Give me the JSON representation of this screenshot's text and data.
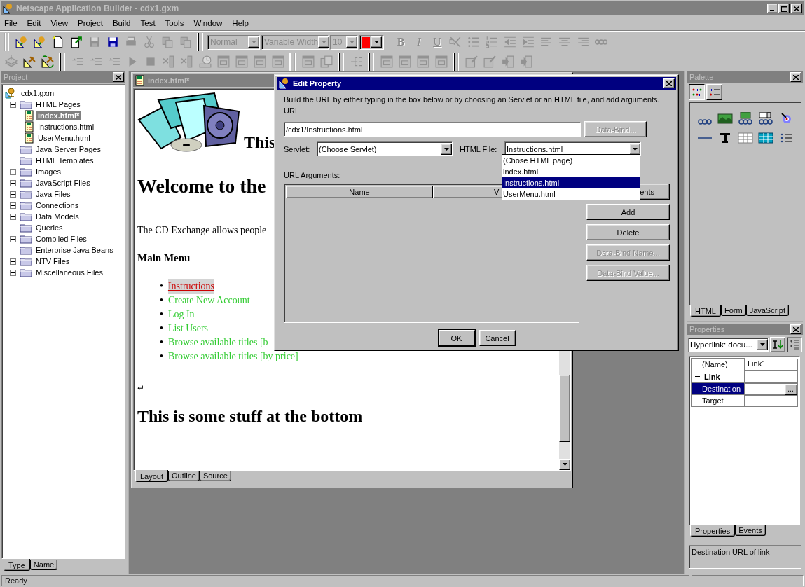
{
  "window": {
    "title": "Netscape Application Builder - cdx1.gxm"
  },
  "menu": [
    "File",
    "Edit",
    "View",
    "Project",
    "Build",
    "Test",
    "Tools",
    "Window",
    "Help"
  ],
  "toolbars": [
    {
      "items": [
        {
          "kind": "separator"
        },
        {
          "kind": "icon",
          "disabled": false
        },
        {
          "kind": "icon",
          "disabled": false
        },
        {
          "kind": "icon",
          "disabled": false
        },
        {
          "kind": "icon",
          "disabled": false
        },
        {
          "kind": "icon",
          "disabled": true
        },
        {
          "kind": "icon",
          "disabled": false
        },
        {
          "kind": "icon",
          "disabled": true
        },
        {
          "kind": "icon",
          "disabled": true
        },
        {
          "kind": "icon",
          "disabled": true
        },
        {
          "kind": "icon",
          "disabled": true
        },
        {
          "kind": "separator"
        },
        {
          "kind": "combo",
          "value": "Normal",
          "disabled": true
        },
        {
          "kind": "combo",
          "value": "Variable Width",
          "disabled": true
        },
        {
          "kind": "combo",
          "value": "10",
          "disabled": true
        },
        {
          "kind": "color",
          "color": "#ff0000"
        },
        {
          "kind": "letter",
          "label": "B",
          "disabled": true
        },
        {
          "kind": "letter",
          "label": "I",
          "disabled": true
        },
        {
          "kind": "letter",
          "label": "U",
          "disabled": true
        },
        {
          "kind": "icon",
          "disabled": true
        },
        {
          "kind": "icon",
          "disabled": true
        },
        {
          "kind": "icon",
          "disabled": true
        },
        {
          "kind": "icon",
          "disabled": true
        },
        {
          "kind": "icon",
          "disabled": true
        },
        {
          "kind": "icon",
          "disabled": true
        },
        {
          "kind": "icon",
          "disabled": true
        },
        {
          "kind": "icon",
          "disabled": true
        },
        {
          "kind": "icon",
          "disabled": true
        }
      ]
    },
    {
      "items": [
        {
          "kind": "icon",
          "disabled": true
        },
        {
          "kind": "icon",
          "disabled": false
        },
        {
          "kind": "icon",
          "disabled": false
        },
        {
          "kind": "separator"
        },
        {
          "kind": "icon",
          "disabled": true
        },
        {
          "kind": "icon",
          "disabled": true
        },
        {
          "kind": "icon",
          "disabled": true
        },
        {
          "kind": "icon",
          "disabled": true
        },
        {
          "kind": "icon",
          "disabled": true
        },
        {
          "kind": "icon",
          "disabled": true
        },
        {
          "kind": "icon",
          "disabled": true
        },
        {
          "kind": "icon",
          "disabled": true
        },
        {
          "kind": "icon",
          "disabled": true
        },
        {
          "kind": "icon",
          "disabled": true
        },
        {
          "kind": "icon",
          "disabled": true
        },
        {
          "kind": "icon",
          "disabled": true
        },
        {
          "kind": "separator"
        },
        {
          "kind": "icon",
          "disabled": true
        },
        {
          "kind": "icon",
          "disabled": true
        },
        {
          "kind": "separator"
        },
        {
          "kind": "icon",
          "disabled": true
        },
        {
          "kind": "separator"
        },
        {
          "kind": "icon",
          "disabled": true
        },
        {
          "kind": "icon",
          "disabled": true
        },
        {
          "kind": "icon",
          "disabled": true
        },
        {
          "kind": "icon",
          "disabled": true
        },
        {
          "kind": "separator"
        },
        {
          "kind": "icon",
          "disabled": true
        },
        {
          "kind": "icon",
          "disabled": true
        },
        {
          "kind": "icon",
          "disabled": true
        },
        {
          "kind": "icon",
          "disabled": true
        }
      ]
    }
  ],
  "project_panel": {
    "title": "Project",
    "tree": [
      {
        "kind": "project",
        "label": "cdx1.gxm",
        "selected": false,
        "children": [
          {
            "kind": "folder",
            "label": "HTML Pages",
            "selected": false,
            "expanded": true,
            "children": [
              {
                "kind": "page",
                "label": "index.html*",
                "selected": true
              },
              {
                "kind": "page",
                "label": "Instructions.html",
                "selected": false
              },
              {
                "kind": "page",
                "label": "UserMenu.html",
                "selected": false
              }
            ]
          },
          {
            "kind": "folder",
            "label": "Java Server Pages",
            "selected": false
          },
          {
            "kind": "folder",
            "label": "HTML Templates",
            "selected": false
          },
          {
            "kind": "folder",
            "label": "Images",
            "selected": false,
            "expanded": false
          },
          {
            "kind": "folder",
            "label": "JavaScript Files",
            "selected": false,
            "expanded": false
          },
          {
            "kind": "folder",
            "label": "Java Files",
            "selected": false,
            "expanded": false
          },
          {
            "kind": "folder",
            "label": "Connections",
            "selected": false,
            "expanded": false
          },
          {
            "kind": "folder",
            "label": "Data Models",
            "selected": false,
            "expanded": false
          },
          {
            "kind": "folder",
            "label": "Queries",
            "selected": false
          },
          {
            "kind": "folder",
            "label": "Compiled Files",
            "selected": false,
            "expanded": false
          },
          {
            "kind": "folder",
            "label": "Enterprise Java Beans",
            "selected": false
          },
          {
            "kind": "folder",
            "label": "NTV Files",
            "selected": false,
            "expanded": false
          },
          {
            "kind": "folder",
            "label": "Miscellaneous Files",
            "selected": false,
            "expanded": false
          }
        ]
      }
    ],
    "tabs": [
      {
        "label": "Type",
        "selected": true
      },
      {
        "label": "Name",
        "selected": false
      }
    ]
  },
  "editor": {
    "title": "index.html*",
    "heading_top": "This",
    "heading_welcome": "Welcome to the",
    "paragraph": "The CD Exchange allows people",
    "subheading": "Main Menu",
    "links": [
      {
        "bullet": "•",
        "text": "Instructions",
        "selected": true
      },
      {
        "bullet": "•",
        "text": "Create New Account",
        "selected": false
      },
      {
        "bullet": "•",
        "text": "Log In",
        "selected": false
      },
      {
        "bullet": "•",
        "text": "List Users",
        "selected": false
      },
      {
        "bullet": "•",
        "text": "Browse available titles [b",
        "selected": false
      },
      {
        "bullet": "•",
        "text": "Browse available titles [by price]",
        "selected": false
      }
    ],
    "paragraph_mark": "↵",
    "heading_bottom": "This is some stuff at the bottom",
    "tabs": [
      {
        "label": "Layout",
        "selected": true
      },
      {
        "label": "Outline",
        "selected": false
      },
      {
        "label": "Source",
        "selected": false
      }
    ]
  },
  "palette": {
    "title": "Palette",
    "views": [
      {
        "selected": true
      },
      {
        "selected": false
      }
    ],
    "tabs": [
      {
        "label": "HTML",
        "selected": true
      },
      {
        "label": "Form",
        "selected": false
      },
      {
        "label": "JavaScript",
        "selected": false
      }
    ]
  },
  "properties": {
    "title": "Properties",
    "object": "Hyperlink: docu...",
    "rows": [
      {
        "kind": "property",
        "name": "(Name)",
        "value": "Link1",
        "selected": false
      },
      {
        "kind": "category",
        "name": "Link",
        "expanded": true
      },
      {
        "kind": "property",
        "name": "Destination",
        "button": "...",
        "selected": true
      },
      {
        "kind": "property",
        "name": "Target",
        "selected": false
      }
    ],
    "tabs": [
      {
        "label": "Properties",
        "selected": true
      },
      {
        "label": "Events",
        "selected": false
      }
    ],
    "description": "Destination URL of link"
  },
  "dialog": {
    "title": "Edit Property",
    "instructions": "Build the URL by either typing in the box below or by choosing an Servlet or an HTML file, and add arguments.",
    "url_label": "URL",
    "url": "/cdx1/Instructions.html",
    "data_bind": {
      "label": "Data-Bind...",
      "disabled": true
    },
    "servlet_label": "Servlet:",
    "servlet": "(Choose Servlet)",
    "html_file_label": "HTML File:",
    "html_file": "Instructions.html",
    "html_file_options": [
      {
        "label": "(Chose HTML page)",
        "selected": false
      },
      {
        "label": "index.html",
        "selected": false
      },
      {
        "label": "Instructions.html",
        "selected": true
      },
      {
        "label": "UserMenu.html",
        "selected": false
      }
    ],
    "arguments_label": "URL Arguments:",
    "argument_columns": [
      "Name",
      "V"
    ],
    "side_buttons": [
      {
        "label": "ents",
        "disabled": false
      },
      {
        "label": "Add",
        "disabled": false
      },
      {
        "label": "Delete",
        "disabled": false
      },
      {
        "label": "Data-Bind Name...",
        "disabled": true
      },
      {
        "label": "Data-Bind Value...",
        "disabled": true
      }
    ],
    "buttons": [
      {
        "label": "OK",
        "default": true
      },
      {
        "label": "Cancel",
        "default": false
      }
    ]
  },
  "status_bar": {
    "text": "Ready"
  }
}
